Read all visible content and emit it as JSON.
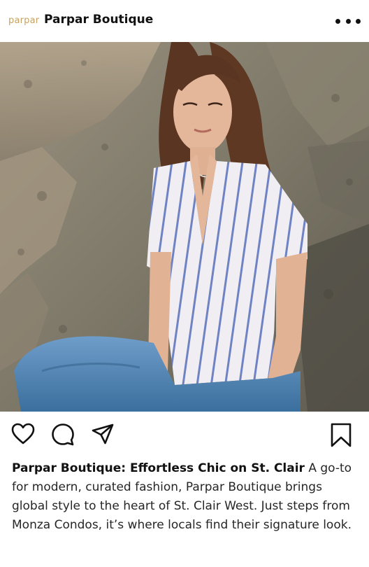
{
  "header": {
    "avatar_text": "parpar",
    "account_name": "Parpar Boutique",
    "more_icon": "more-dots-icon"
  },
  "post": {
    "image_icon": "photo-woman-striped-shirt"
  },
  "actions": {
    "like_icon": "heart-icon",
    "comment_icon": "comment-icon",
    "share_icon": "send-icon",
    "save_icon": "bookmark-icon"
  },
  "caption": {
    "title": "Parpar Boutique: Effortless Chic on St. Clair",
    "body": " A go-to for modern, curated fashion, Parpar Boutique brings global style to the heart of St. Clair West. Just steps from Monza Condos, it’s where locals find their signature look."
  },
  "colors": {
    "brand": "#c7a261",
    "text": "#262626"
  }
}
